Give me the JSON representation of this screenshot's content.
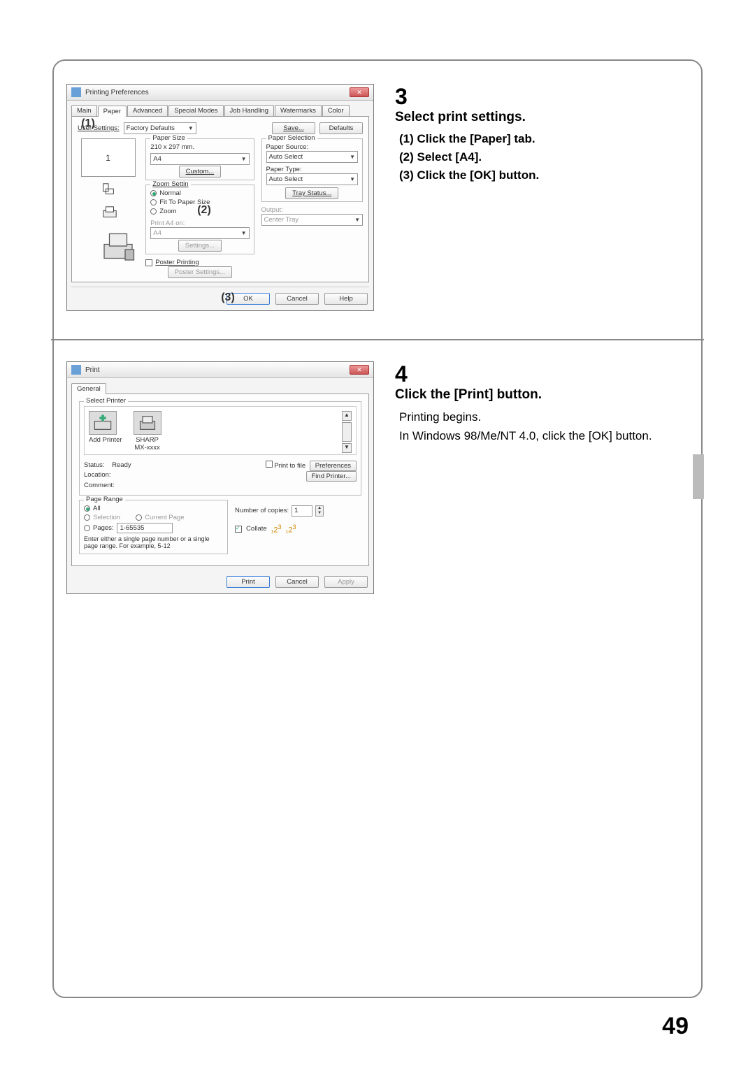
{
  "page_number": "49",
  "step3": {
    "num": "3",
    "title": "Select print settings.",
    "sub1": "(1)  Click the [Paper] tab.",
    "sub2": "(2)  Select [A4].",
    "sub3": "(3)  Click the [OK] button."
  },
  "step4": {
    "num": "4",
    "title": "Click the [Print] button.",
    "desc1": "Printing begins.",
    "desc2": "In Windows 98/Me/NT 4.0, click the [OK] button."
  },
  "prefs": {
    "title": "Printing Preferences",
    "tabs": {
      "main": "Main",
      "paper": "Paper",
      "advanced": "Advanced",
      "special": "Special Modes",
      "job": "Job Handling",
      "watermarks": "Watermarks",
      "color": "Color"
    },
    "user_settings_label": "User Settings:",
    "user_settings_value": "Factory Defaults",
    "save": "Save...",
    "defaults": "Defaults",
    "preview_number": "1",
    "paper_size": {
      "legend": "Paper Size",
      "dims": "210 x 297 mm.",
      "value": "A4",
      "custom": "Custom..."
    },
    "zoom": {
      "legend": "Zoom Settin",
      "normal": "Normal",
      "fit": "Fit To Paper Size",
      "zoom": "Zoom",
      "print_on": "Print A4 on:",
      "a4": "A4",
      "settings": "Settings..."
    },
    "poster_cb": "Poster Printing",
    "poster_btn": "Poster Settings...",
    "paper_selection": {
      "legend": "Paper Selection",
      "source_label": "Paper Source:",
      "source_value": "Auto Select",
      "type_label": "Paper Type:",
      "type_value": "Auto Select",
      "tray": "Tray Status..."
    },
    "output": {
      "label": "Output:",
      "value": "Center Tray"
    },
    "ok": "OK",
    "cancel": "Cancel",
    "help": "Help",
    "annot1": "(1)",
    "annot2": "(2)",
    "annot3": "(3)"
  },
  "print": {
    "title": "Print",
    "tab_general": "General",
    "select_printer": "Select Printer",
    "add_printer": "Add Printer",
    "sharp": "SHARP",
    "sharp_model": "MX-xxxx",
    "status_label": "Status:",
    "status_value": "Ready",
    "location_label": "Location:",
    "comment_label": "Comment:",
    "print_to_file": "Print to file",
    "preferences": "Preferences",
    "find_printer": "Find Printer...",
    "page_range": "Page Range",
    "all": "All",
    "selection": "Selection",
    "current_page": "Current Page",
    "pages_label": "Pages:",
    "pages_value": "1-65535",
    "pages_hint": "Enter either a single page number or a single page range.  For example, 5-12",
    "copies_label": "Number of copies:",
    "copies_value": "1",
    "collate": "Collate",
    "print_btn": "Print",
    "cancel": "Cancel",
    "apply": "Apply"
  }
}
